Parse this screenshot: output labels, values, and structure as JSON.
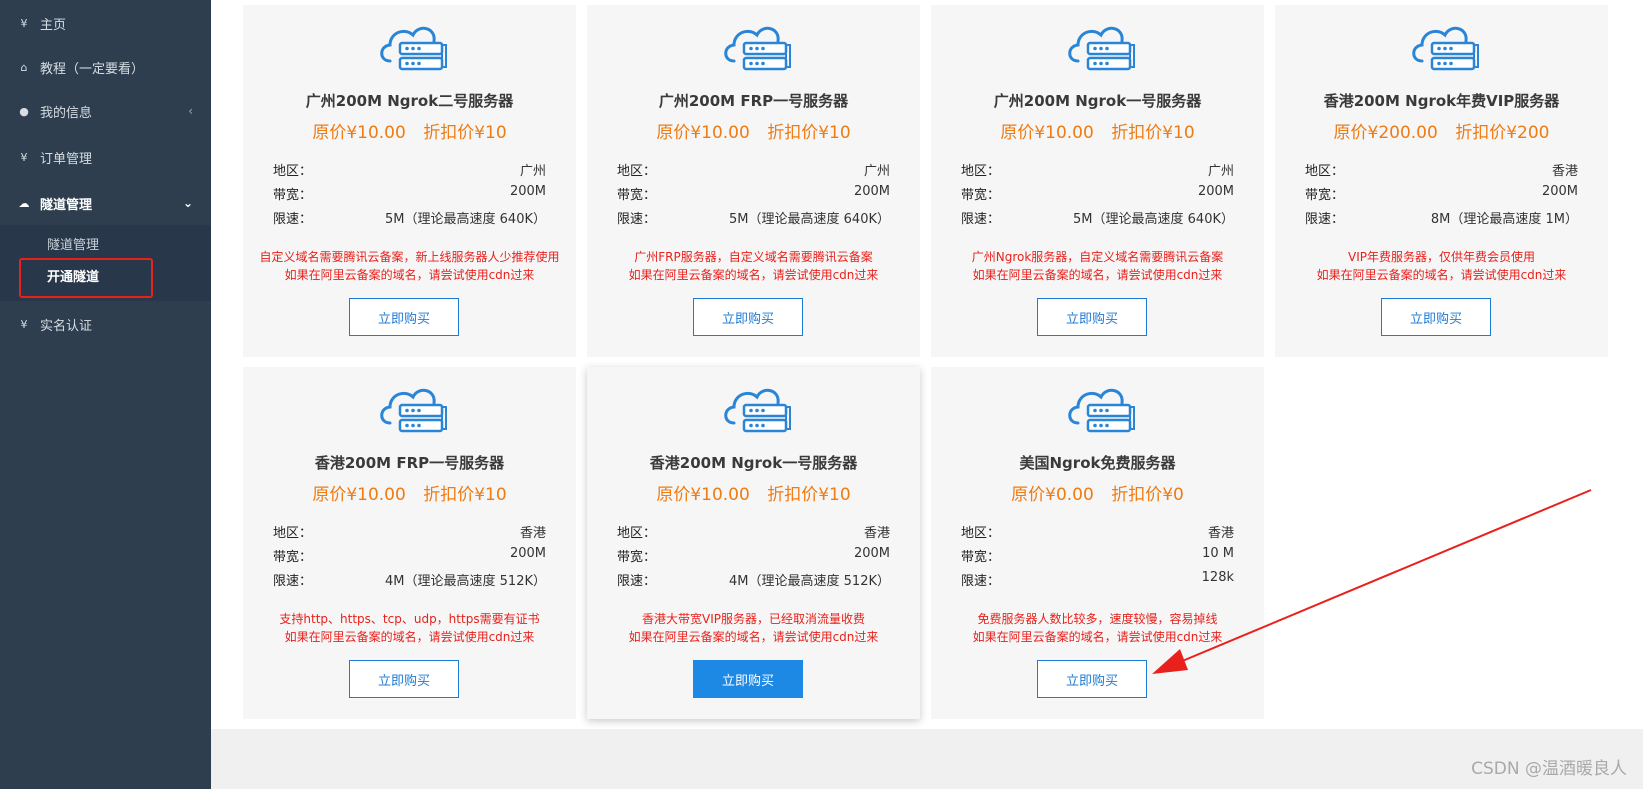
{
  "sidebar": {
    "items": [
      {
        "icon": "yen-icon",
        "glyph": "¥",
        "label": "主页"
      },
      {
        "icon": "home-icon",
        "glyph": "⌂",
        "label": "教程（一定要看）"
      },
      {
        "icon": "user-icon",
        "glyph": "●",
        "label": "我的信息",
        "chevron": "‹"
      },
      {
        "icon": "yen-icon",
        "glyph": "¥",
        "label": "订单管理"
      },
      {
        "icon": "cloud-icon",
        "glyph": "☁",
        "label": "隧道管理",
        "chevron": "⌄"
      },
      {
        "icon": "yen-icon",
        "glyph": "¥",
        "label": "实名认证"
      }
    ],
    "submenu": [
      "隧道管理",
      "开通隧道"
    ]
  },
  "cards": [
    {
      "title": "广州200M Ngrok二号服务器",
      "original": "原价¥10.00",
      "discount": "折扣价¥10",
      "specs": [
        [
          "地区：",
          "广州"
        ],
        [
          "带宽：",
          "200M"
        ],
        [
          "限速：",
          "5M（理论最高速度 640K）"
        ]
      ],
      "notes": [
        "自定义域名需要腾讯云备案，新上线服务器人少推荐使用",
        "如果在阿里云备案的域名，请尝试使用cdn过来"
      ],
      "button": "立即购买"
    },
    {
      "title": "广州200M FRP一号服务器",
      "original": "原价¥10.00",
      "discount": "折扣价¥10",
      "specs": [
        [
          "地区：",
          "广州"
        ],
        [
          "带宽：",
          "200M"
        ],
        [
          "限速：",
          "5M（理论最高速度 640K）"
        ]
      ],
      "notes": [
        "广州FRP服务器，自定义域名需要腾讯云备案",
        "如果在阿里云备案的域名，请尝试使用cdn过来"
      ],
      "button": "立即购买"
    },
    {
      "title": "广州200M Ngrok一号服务器",
      "original": "原价¥10.00",
      "discount": "折扣价¥10",
      "specs": [
        [
          "地区：",
          "广州"
        ],
        [
          "带宽：",
          "200M"
        ],
        [
          "限速：",
          "5M（理论最高速度 640K）"
        ]
      ],
      "notes": [
        "广州Ngrok服务器，自定义域名需要腾讯云备案",
        "如果在阿里云备案的域名，请尝试使用cdn过来"
      ],
      "button": "立即购买"
    },
    {
      "title": "香港200M Ngrok年费VIP服务器",
      "original": "原价¥200.00",
      "discount": "折扣价¥200",
      "specs": [
        [
          "地区：",
          "香港"
        ],
        [
          "带宽：",
          "200M"
        ],
        [
          "限速：",
          "8M（理论最高速度 1M）"
        ]
      ],
      "notes": [
        "VIP年费服务器，仅供年费会员使用",
        "如果在阿里云备案的域名，请尝试使用cdn过来"
      ],
      "button": "立即购买"
    },
    {
      "title": "香港200M FRP一号服务器",
      "original": "原价¥10.00",
      "discount": "折扣价¥10",
      "specs": [
        [
          "地区：",
          "香港"
        ],
        [
          "带宽：",
          "200M"
        ],
        [
          "限速：",
          "4M（理论最高速度 512K）"
        ]
      ],
      "notes": [
        "支持http、https、tcp、udp，https需要有证书",
        "如果在阿里云备案的域名，请尝试使用cdn过来"
      ],
      "button": "立即购买"
    },
    {
      "title": "香港200M Ngrok一号服务器",
      "original": "原价¥10.00",
      "discount": "折扣价¥10",
      "specs": [
        [
          "地区：",
          "香港"
        ],
        [
          "带宽：",
          "200M"
        ],
        [
          "限速：",
          "4M（理论最高速度 512K）"
        ]
      ],
      "notes": [
        "香港大带宽VIP服务器，已经取消流量收费",
        "如果在阿里云备案的域名，请尝试使用cdn过来"
      ],
      "button": "立即购买"
    },
    {
      "title": "美国Ngrok免费服务器",
      "original": "原价¥0.00",
      "discount": "折扣价¥0",
      "specs": [
        [
          "地区：",
          "香港"
        ],
        [
          "带宽：",
          "10 M"
        ],
        [
          "限速：",
          "128k"
        ]
      ],
      "notes": [
        "免费服务器人数比较多，速度较慢，容易掉线",
        "如果在阿里云备案的域名，请尝试使用cdn过来"
      ],
      "button": "立即购买"
    }
  ],
  "watermark": "CSDN @温酒暖良人",
  "colors": {
    "sidebar": "#2e3e4e",
    "price": "#ef7b13",
    "note": "#e8211c",
    "button": "#1e7bd6",
    "highlight": "#e8211c"
  }
}
